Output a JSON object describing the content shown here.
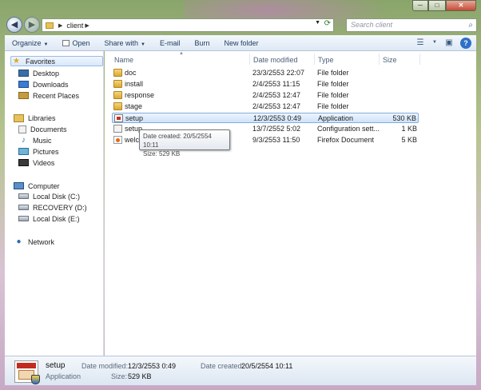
{
  "window": {
    "caption_buttons": {
      "minimize": "─",
      "maximize": "□",
      "close": "✕"
    }
  },
  "address": {
    "breadcrumbs": [
      "client"
    ],
    "search_placeholder": "Search client"
  },
  "toolbar": {
    "organize": "Organize",
    "open": "Open",
    "share_with": "Share with",
    "email": "E-mail",
    "burn": "Burn",
    "new_folder": "New folder"
  },
  "nav": {
    "favorites": {
      "label": "Favorites",
      "items": [
        "Desktop",
        "Downloads",
        "Recent Places"
      ]
    },
    "libraries": {
      "label": "Libraries",
      "items": [
        "Documents",
        "Music",
        "Pictures",
        "Videos"
      ]
    },
    "computer": {
      "label": "Computer",
      "items": [
        "Local Disk (C:)",
        "RECOVERY (D:)",
        "Local Disk (E:)"
      ]
    },
    "network": {
      "label": "Network"
    }
  },
  "columns": {
    "name": "Name",
    "date_modified": "Date modified",
    "type": "Type",
    "size": "Size"
  },
  "files": [
    {
      "name": "doc",
      "date": "23/3/2553 22:07",
      "type": "File folder",
      "size": "",
      "icon": "folder-icon"
    },
    {
      "name": "install",
      "date": "2/4/2553 11:15",
      "type": "File folder",
      "size": "",
      "icon": "folder-icon"
    },
    {
      "name": "response",
      "date": "2/4/2553 12:47",
      "type": "File folder",
      "size": "",
      "icon": "folder-icon"
    },
    {
      "name": "stage",
      "date": "2/4/2553 12:47",
      "type": "File folder",
      "size": "",
      "icon": "folder-icon"
    },
    {
      "name": "setup",
      "date": "12/3/2553 0:49",
      "type": "Application",
      "size": "530 KB",
      "icon": "application-icon"
    },
    {
      "name": "setup",
      "date": "13/7/2552 5:02",
      "type": "Configuration sett...",
      "size": "1 KB",
      "icon": "config-file-icon"
    },
    {
      "name": "welco",
      "date": "9/3/2553 11:50",
      "type": "Firefox Document",
      "size": "5 KB",
      "icon": "firefox-document-icon"
    }
  ],
  "tooltip": {
    "line1": "Date created: 20/5/2554 10:11",
    "line2": "Size: 529 KB"
  },
  "details": {
    "name": "setup",
    "type": "Application",
    "date_modified_label": "Date modified:",
    "date_modified": "12/3/2553 0:49",
    "date_created_label": "Date created:",
    "date_created": "20/5/2554 10:11",
    "size_label": "Size:",
    "size": "529 KB"
  }
}
